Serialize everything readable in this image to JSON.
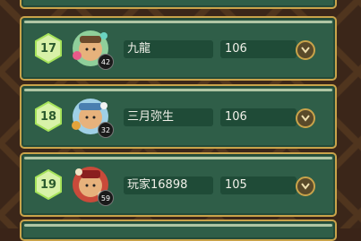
{
  "leaderboard": {
    "rows": [
      {
        "rank": "17",
        "name": "九龍",
        "score": "106",
        "level": "42"
      },
      {
        "rank": "18",
        "name": "三月弥生",
        "score": "106",
        "level": "32"
      },
      {
        "rank": "19",
        "name": "玩家16898",
        "score": "105",
        "level": "59"
      }
    ]
  },
  "colors": {
    "card_bg": "#2f5e48",
    "card_border": "#c9a34a",
    "field_bg": "#1f4b37",
    "rank_hex": "#a6e35a"
  },
  "icons": {
    "expand": "chevron-down-icon",
    "rank": "hexagon-badge-icon"
  }
}
